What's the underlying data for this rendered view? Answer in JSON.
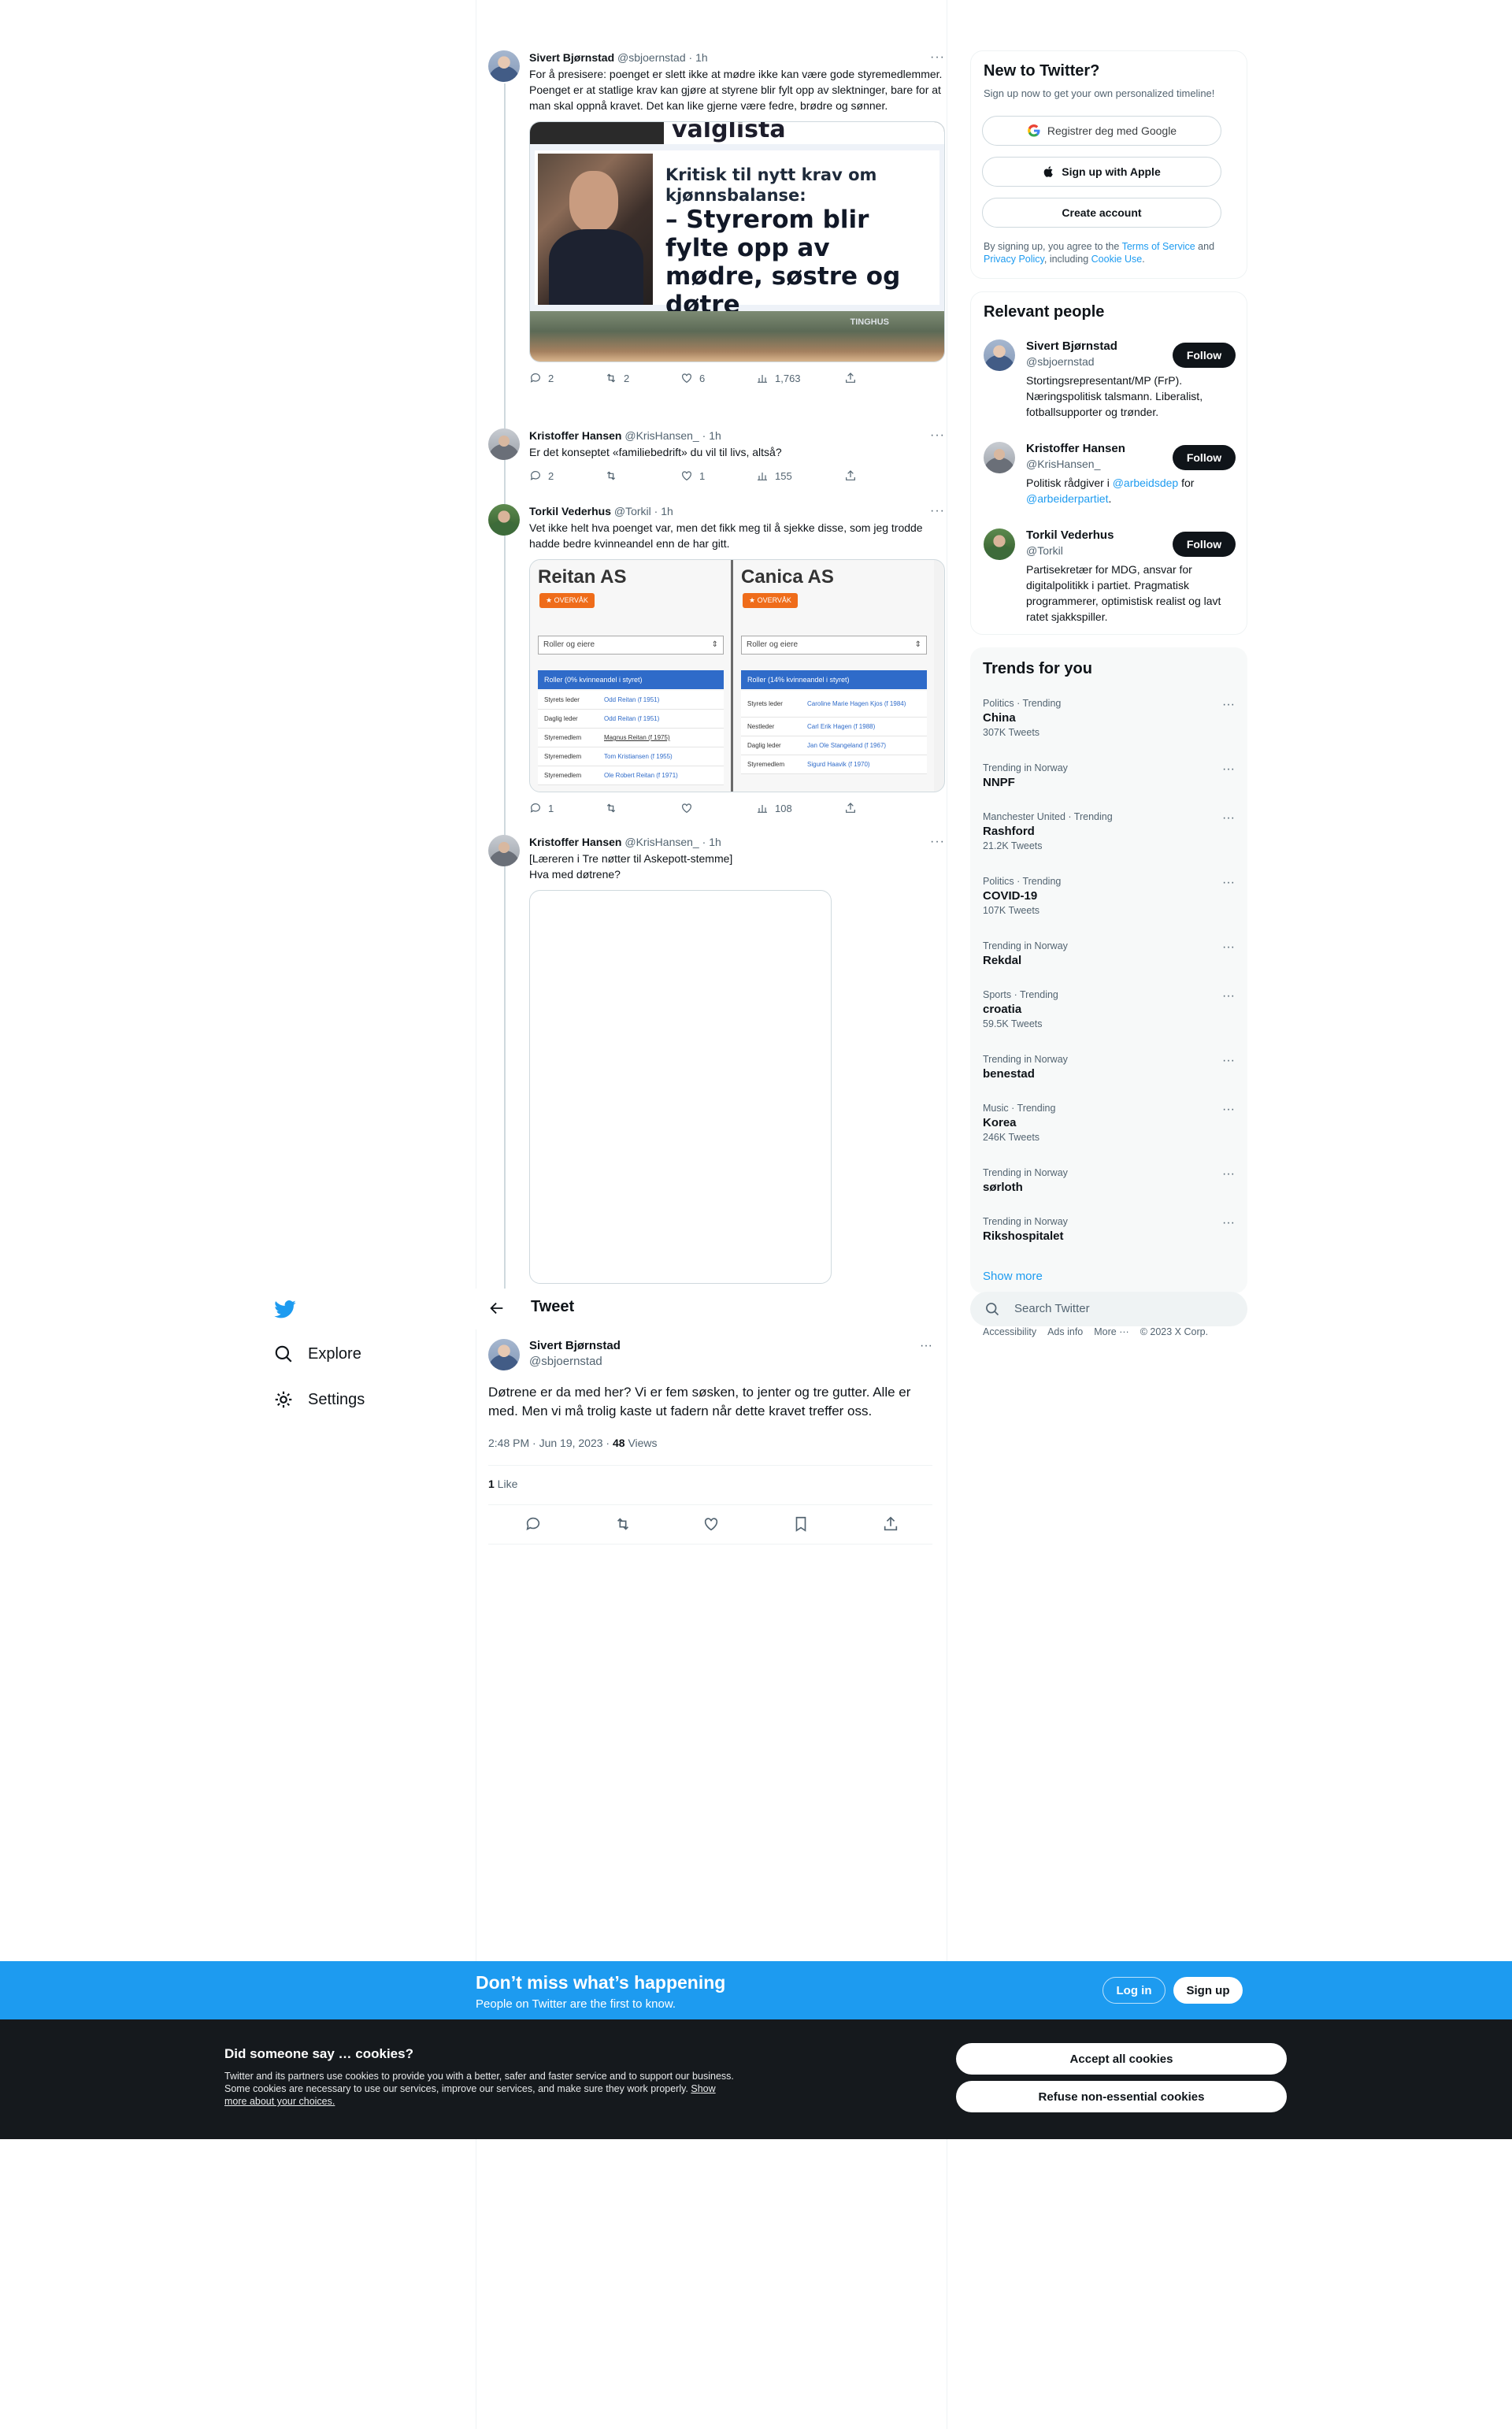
{
  "colors": {
    "accent": "#1d9bf0",
    "text": "#0f1419",
    "muted": "#536471",
    "cookie_bg": "#15191d",
    "orange_badge": "#ef6c1a"
  },
  "thread": [
    {
      "name": "Sivert Bjørnstad",
      "handle": "@sbjoernstad",
      "time": "1h",
      "text": "For å presisere: poenget er slett ikke at mødre ikke kan være gode styremedlemmer. Poenget er at statlige krav kan gjøre at styrene blir fylt opp av slektninger, bare for at man skal oppnå kravet. Det kan like gjerne være fedre, brødre og sønner.",
      "media": {
        "top_word": "valglista",
        "subtitle": "Kritisk til nytt krav om kjønnsbalanse:",
        "headline": "– Styrerom blir fylte opp av mødre, søstre og døtre",
        "sign_text": "TINGHUS"
      },
      "replies": "2",
      "retweets": "2",
      "likes": "6",
      "views": "1,763"
    },
    {
      "name": "Kristoffer Hansen",
      "handle": "@KrisHansen_",
      "time": "1h",
      "text": "Er det konseptet «familiebedrift» du vil til livs, altså?",
      "replies": "2",
      "retweets": "",
      "likes": "1",
      "views": "155"
    },
    {
      "name": "Torkil Vederhus",
      "handle": "@Torkil",
      "time": "1h",
      "text": "Vet ikke helt hva poenget var, men det fikk meg til å sjekke disse, som jeg trodde hadde bedre kvinneandel enn de har gitt.",
      "companies": [
        {
          "title": "Reitan AS",
          "badge": "OVERVÅK",
          "select": "Roller og eiere",
          "roles_header": "Roller (0% kvinneandel i styret)",
          "rows": [
            {
              "role": "Styrets leder",
              "person": "Odd Reitan (f 1951)"
            },
            {
              "role": "Daglig leder",
              "person": "Odd Reitan (f 1951)"
            },
            {
              "role": "Styremedlem",
              "person": "Magnus Reitan (f 1975)"
            },
            {
              "role": "Styremedlem",
              "person": "Tom Kristiansen (f 1955)"
            },
            {
              "role": "Styremedlem",
              "person": "Ole Robert Reitan (f 1971)"
            }
          ]
        },
        {
          "title": "Canica AS",
          "badge": "OVERVÅK",
          "select": "Roller og eiere",
          "roles_header": "Roller (14% kvinneandel i styret)",
          "rows": [
            {
              "role": "Styrets leder",
              "person": "Caroline Marie Hagen Kjos (f 1984)"
            },
            {
              "role": "Nestleder",
              "person": "Carl Erik Hagen (f 1988)"
            },
            {
              "role": "Daglig leder",
              "person": "Jan Ole Stangeland (f 1967)"
            },
            {
              "role": "Styremedlem",
              "person": "Sigurd Haavik (f 1970)"
            }
          ]
        }
      ],
      "replies": "1",
      "retweets": "",
      "likes": "",
      "views": "108"
    },
    {
      "name": "Kristoffer Hansen",
      "handle": "@KrisHansen_",
      "time": "1h",
      "text_line1": "[Læreren i Tre nøtter til Askepott-stemme]",
      "text_line2": "Hva med døtrene?"
    }
  ],
  "nav": {
    "explore": "Explore",
    "settings": "Settings"
  },
  "focal": {
    "header": "Tweet",
    "name": "Sivert Bjørnstad",
    "handle": "@sbjoernstad",
    "text": "Døtrene er da med her? Vi er fem søsken, to jenter og tre gutter. Alle er med. Men vi må trolig kaste ut fadern når dette kravet treffer oss.",
    "timestamp": "2:48 PM · Jun 19, 2023 · ",
    "views_count": "48",
    "views_label": " Views",
    "likes_count": "1",
    "likes_label": " Like"
  },
  "new_to_twitter": {
    "title": "New to Twitter?",
    "subtitle": "Sign up now to get your own personalized timeline!",
    "google_label": "Registrer deg med Google",
    "apple_label": "Sign up with Apple",
    "create_label": "Create account",
    "legal_pre": "By signing up, you agree to the ",
    "terms": "Terms of Service",
    "legal_mid": " and ",
    "privacy": "Privacy Policy",
    "legal_mid2": ", including ",
    "cookie_use": "Cookie Use",
    "legal_end": "."
  },
  "relevant": {
    "title": "Relevant people",
    "follow_label": "Follow",
    "people": [
      {
        "name": "Sivert Bjørnstad",
        "handle": "@sbjoernstad",
        "bio": "Stortingsrepresentant/MP (FrP). Næringspolitisk talsmann. Liberalist, fotballsupporter og trønder."
      },
      {
        "name": "Kristoffer Hansen",
        "handle": "@KrisHansen_",
        "bio_pre": "Politisk rådgiver i ",
        "bio_link1": "@arbeidsdep",
        "bio_mid": " for ",
        "bio_link2": "@arbeiderpartiet",
        "bio_end": "."
      },
      {
        "name": "Torkil Vederhus",
        "handle": "@Torkil",
        "bio": "Partisekretær for MDG, ansvar for digitalpolitikk i partiet. Pragmatisk programmerer, optimistisk realist og lavt ratet sjakkspiller."
      }
    ]
  },
  "trends": {
    "title": "Trends for you",
    "items": [
      {
        "context": "Politics · Trending",
        "name": "China",
        "count": "307K Tweets"
      },
      {
        "context": "Trending in Norway",
        "name": "NNPF",
        "count": ""
      },
      {
        "context": "Manchester United · Trending",
        "name": "Rashford",
        "count": "21.2K Tweets"
      },
      {
        "context": "Politics · Trending",
        "name": "COVID-19",
        "count": "107K Tweets"
      },
      {
        "context": "Trending in Norway",
        "name": "Rekdal",
        "count": ""
      },
      {
        "context": "Sports · Trending",
        "name": "croatia",
        "count": "59.5K Tweets"
      },
      {
        "context": "Trending in Norway",
        "name": "benestad",
        "count": ""
      },
      {
        "context": "Music · Trending",
        "name": "Korea",
        "count": "246K Tweets"
      },
      {
        "context": "Trending in Norway",
        "name": "sørloth",
        "count": ""
      },
      {
        "context": "Trending in Norway",
        "name": "Rikshospitalet",
        "count": ""
      }
    ],
    "show_more": "Show more"
  },
  "search": {
    "placeholder": "Search Twitter"
  },
  "footer": {
    "accessibility": "Accessibility",
    "ads": "Ads info",
    "more": "More ···",
    "copyright": "© 2023 X Corp."
  },
  "banner": {
    "title": "Don’t miss what’s happening",
    "subtitle": "People on Twitter are the first to know.",
    "login": "Log in",
    "signup": "Sign up"
  },
  "cookies": {
    "title": "Did someone say … cookies?",
    "body": "Twitter and its partners use cookies to provide you with a better, safer and faster service and to support our business. Some cookies are necessary to use our services, improve our services, and make sure they work properly. ",
    "link": "Show more about your choices.",
    "accept": "Accept all cookies",
    "refuse": "Refuse non-essential cookies"
  }
}
